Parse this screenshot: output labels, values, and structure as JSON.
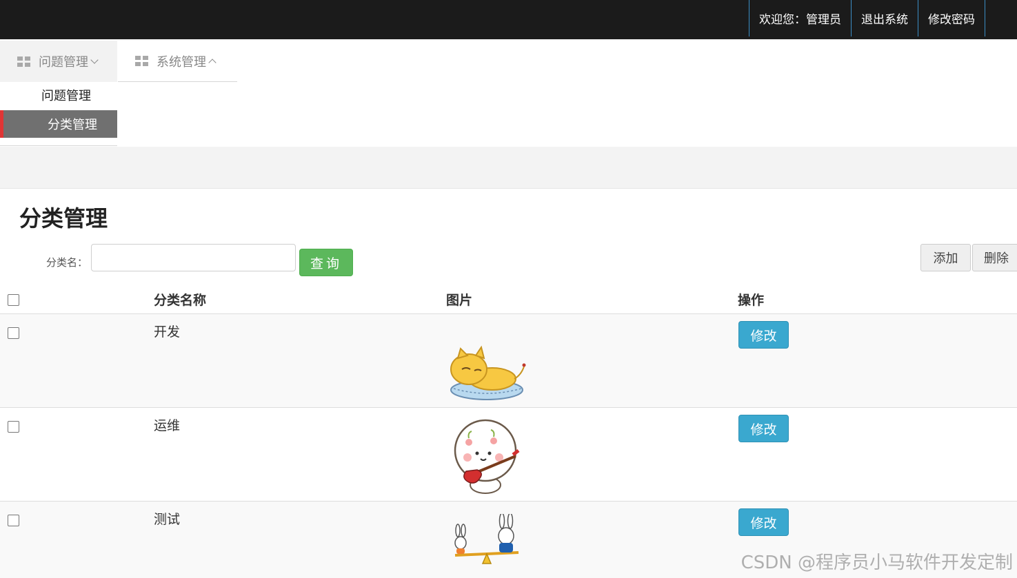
{
  "header": {
    "links": [
      {
        "label": "欢迎您：管理员"
      },
      {
        "label": "退出系统"
      },
      {
        "label": "修改密码"
      }
    ]
  },
  "menu": {
    "tabs": [
      {
        "label": "问题管理",
        "icon": "grid-icon",
        "chevron": "chevron-down-icon"
      },
      {
        "label": "系统管理",
        "icon": "grid-icon",
        "chevron": "chevron-up-icon"
      }
    ],
    "submenu": [
      {
        "label": "问题管理",
        "active": false
      },
      {
        "label": "分类管理",
        "active": true
      }
    ],
    "active_color": "#e03535"
  },
  "page": {
    "title": "分类管理",
    "search_label": "分类名：",
    "search_value": "",
    "query_label": "查询",
    "add_label": "添加",
    "delete_label": "删除"
  },
  "table": {
    "columns": [
      "分类名称",
      "图片",
      "操作"
    ],
    "rows": [
      {
        "name": "开发",
        "image": "lying-cat-sticker",
        "action": "修改"
      },
      {
        "name": "运维",
        "image": "guitar-bun-sticker",
        "action": "修改"
      },
      {
        "name": "测试",
        "image": "bunnies-seesaw-sticker",
        "action": "修改"
      }
    ]
  },
  "watermark": "CSDN @程序员小马软件开发定制",
  "colors": {
    "topbar": "#1b1b1b",
    "query_button": "#5cb85c",
    "edit_button": "#3aa8cf"
  }
}
